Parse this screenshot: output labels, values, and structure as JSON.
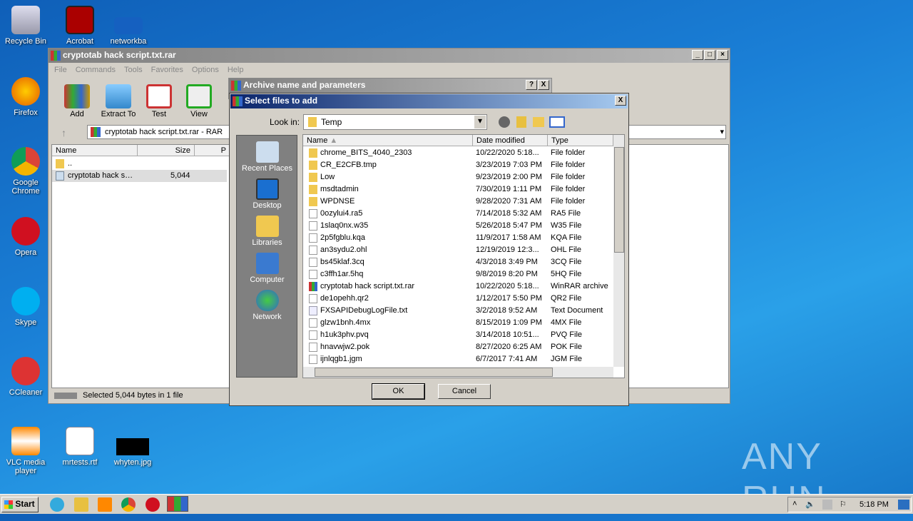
{
  "desktop": {
    "icons": [
      "Recycle Bin",
      "Acrobat",
      "networkba",
      "Firefox",
      "Google Chrome",
      "Opera",
      "Skype",
      "CCleaner",
      "VLC media player",
      "mrtests.rtf",
      "whyten.jpg"
    ]
  },
  "winrar": {
    "title": "cryptotab hack script.txt.rar",
    "menu": [
      "File",
      "Commands",
      "Tools",
      "Favorites",
      "Options",
      "Help"
    ],
    "toolbar": [
      "Add",
      "Extract To",
      "Test",
      "View"
    ],
    "address": "cryptotab hack script.txt.rar - RAR",
    "columns": [
      "Name",
      "Size",
      "P"
    ],
    "rows": [
      {
        "name": "..",
        "size": ""
      },
      {
        "name": "cryptotab hack s…",
        "size": "5,044"
      }
    ],
    "status": "Selected 5,044 bytes in 1 file"
  },
  "archive_dialog": {
    "title": "Archive name and parameters",
    "help": "?",
    "close": "X"
  },
  "select_dialog": {
    "title": "Select files to add",
    "close": "X",
    "look_in_label": "Look in:",
    "look_in_value": "Temp",
    "places": [
      "Recent Places",
      "Desktop",
      "Libraries",
      "Computer",
      "Network"
    ],
    "columns": [
      "Name",
      "Date modified",
      "Type"
    ],
    "files": [
      {
        "name": "chrome_BITS_4040_2303",
        "date": "10/22/2020 5:18...",
        "type": "File folder",
        "kind": "folder"
      },
      {
        "name": "CR_E2CFB.tmp",
        "date": "3/23/2019 7:03 PM",
        "type": "File folder",
        "kind": "folder"
      },
      {
        "name": "Low",
        "date": "9/23/2019 2:00 PM",
        "type": "File folder",
        "kind": "folder"
      },
      {
        "name": "msdtadmin",
        "date": "7/30/2019 1:11 PM",
        "type": "File folder",
        "kind": "folder"
      },
      {
        "name": "WPDNSE",
        "date": "9/28/2020 7:31 AM",
        "type": "File folder",
        "kind": "folder"
      },
      {
        "name": "0ozylui4.ra5",
        "date": "7/14/2018 5:32 AM",
        "type": "RA5 File",
        "kind": "file"
      },
      {
        "name": "1slaq0nx.w35",
        "date": "5/26/2018 5:47 PM",
        "type": "W35 File",
        "kind": "file"
      },
      {
        "name": "2p5fgblu.kqa",
        "date": "11/9/2017 1:58 AM",
        "type": "KQA File",
        "kind": "file"
      },
      {
        "name": "an3sydu2.ohl",
        "date": "12/19/2019 12:3...",
        "type": "OHL File",
        "kind": "file"
      },
      {
        "name": "bs45klaf.3cq",
        "date": "4/3/2018 3:49 PM",
        "type": "3CQ File",
        "kind": "file"
      },
      {
        "name": "c3ffh1ar.5hq",
        "date": "9/8/2019 8:20 PM",
        "type": "5HQ File",
        "kind": "file"
      },
      {
        "name": "cryptotab hack script.txt.rar",
        "date": "10/22/2020 5:18...",
        "type": "WinRAR archive",
        "kind": "rar"
      },
      {
        "name": "de1opehh.qr2",
        "date": "1/12/2017 5:50 PM",
        "type": "QR2 File",
        "kind": "file"
      },
      {
        "name": "FXSAPIDebugLogFile.txt",
        "date": "3/2/2018 9:52 AM",
        "type": "Text Document",
        "kind": "txt"
      },
      {
        "name": "glzw1bnh.4mx",
        "date": "8/15/2019 1:09 PM",
        "type": "4MX File",
        "kind": "file"
      },
      {
        "name": "h1uk3phv.pvq",
        "date": "3/14/2018 10:51...",
        "type": "PVQ File",
        "kind": "file"
      },
      {
        "name": "hnavwjw2.pok",
        "date": "8/27/2020 6:25 AM",
        "type": "POK File",
        "kind": "file"
      },
      {
        "name": "ijnlqgb1.jgm",
        "date": "6/7/2017 7:41 AM",
        "type": "JGM File",
        "kind": "file"
      }
    ],
    "ok": "OK",
    "cancel": "Cancel"
  },
  "taskbar": {
    "start": "Start",
    "clock": "5:18 PM"
  },
  "watermark": "ANY RUN"
}
